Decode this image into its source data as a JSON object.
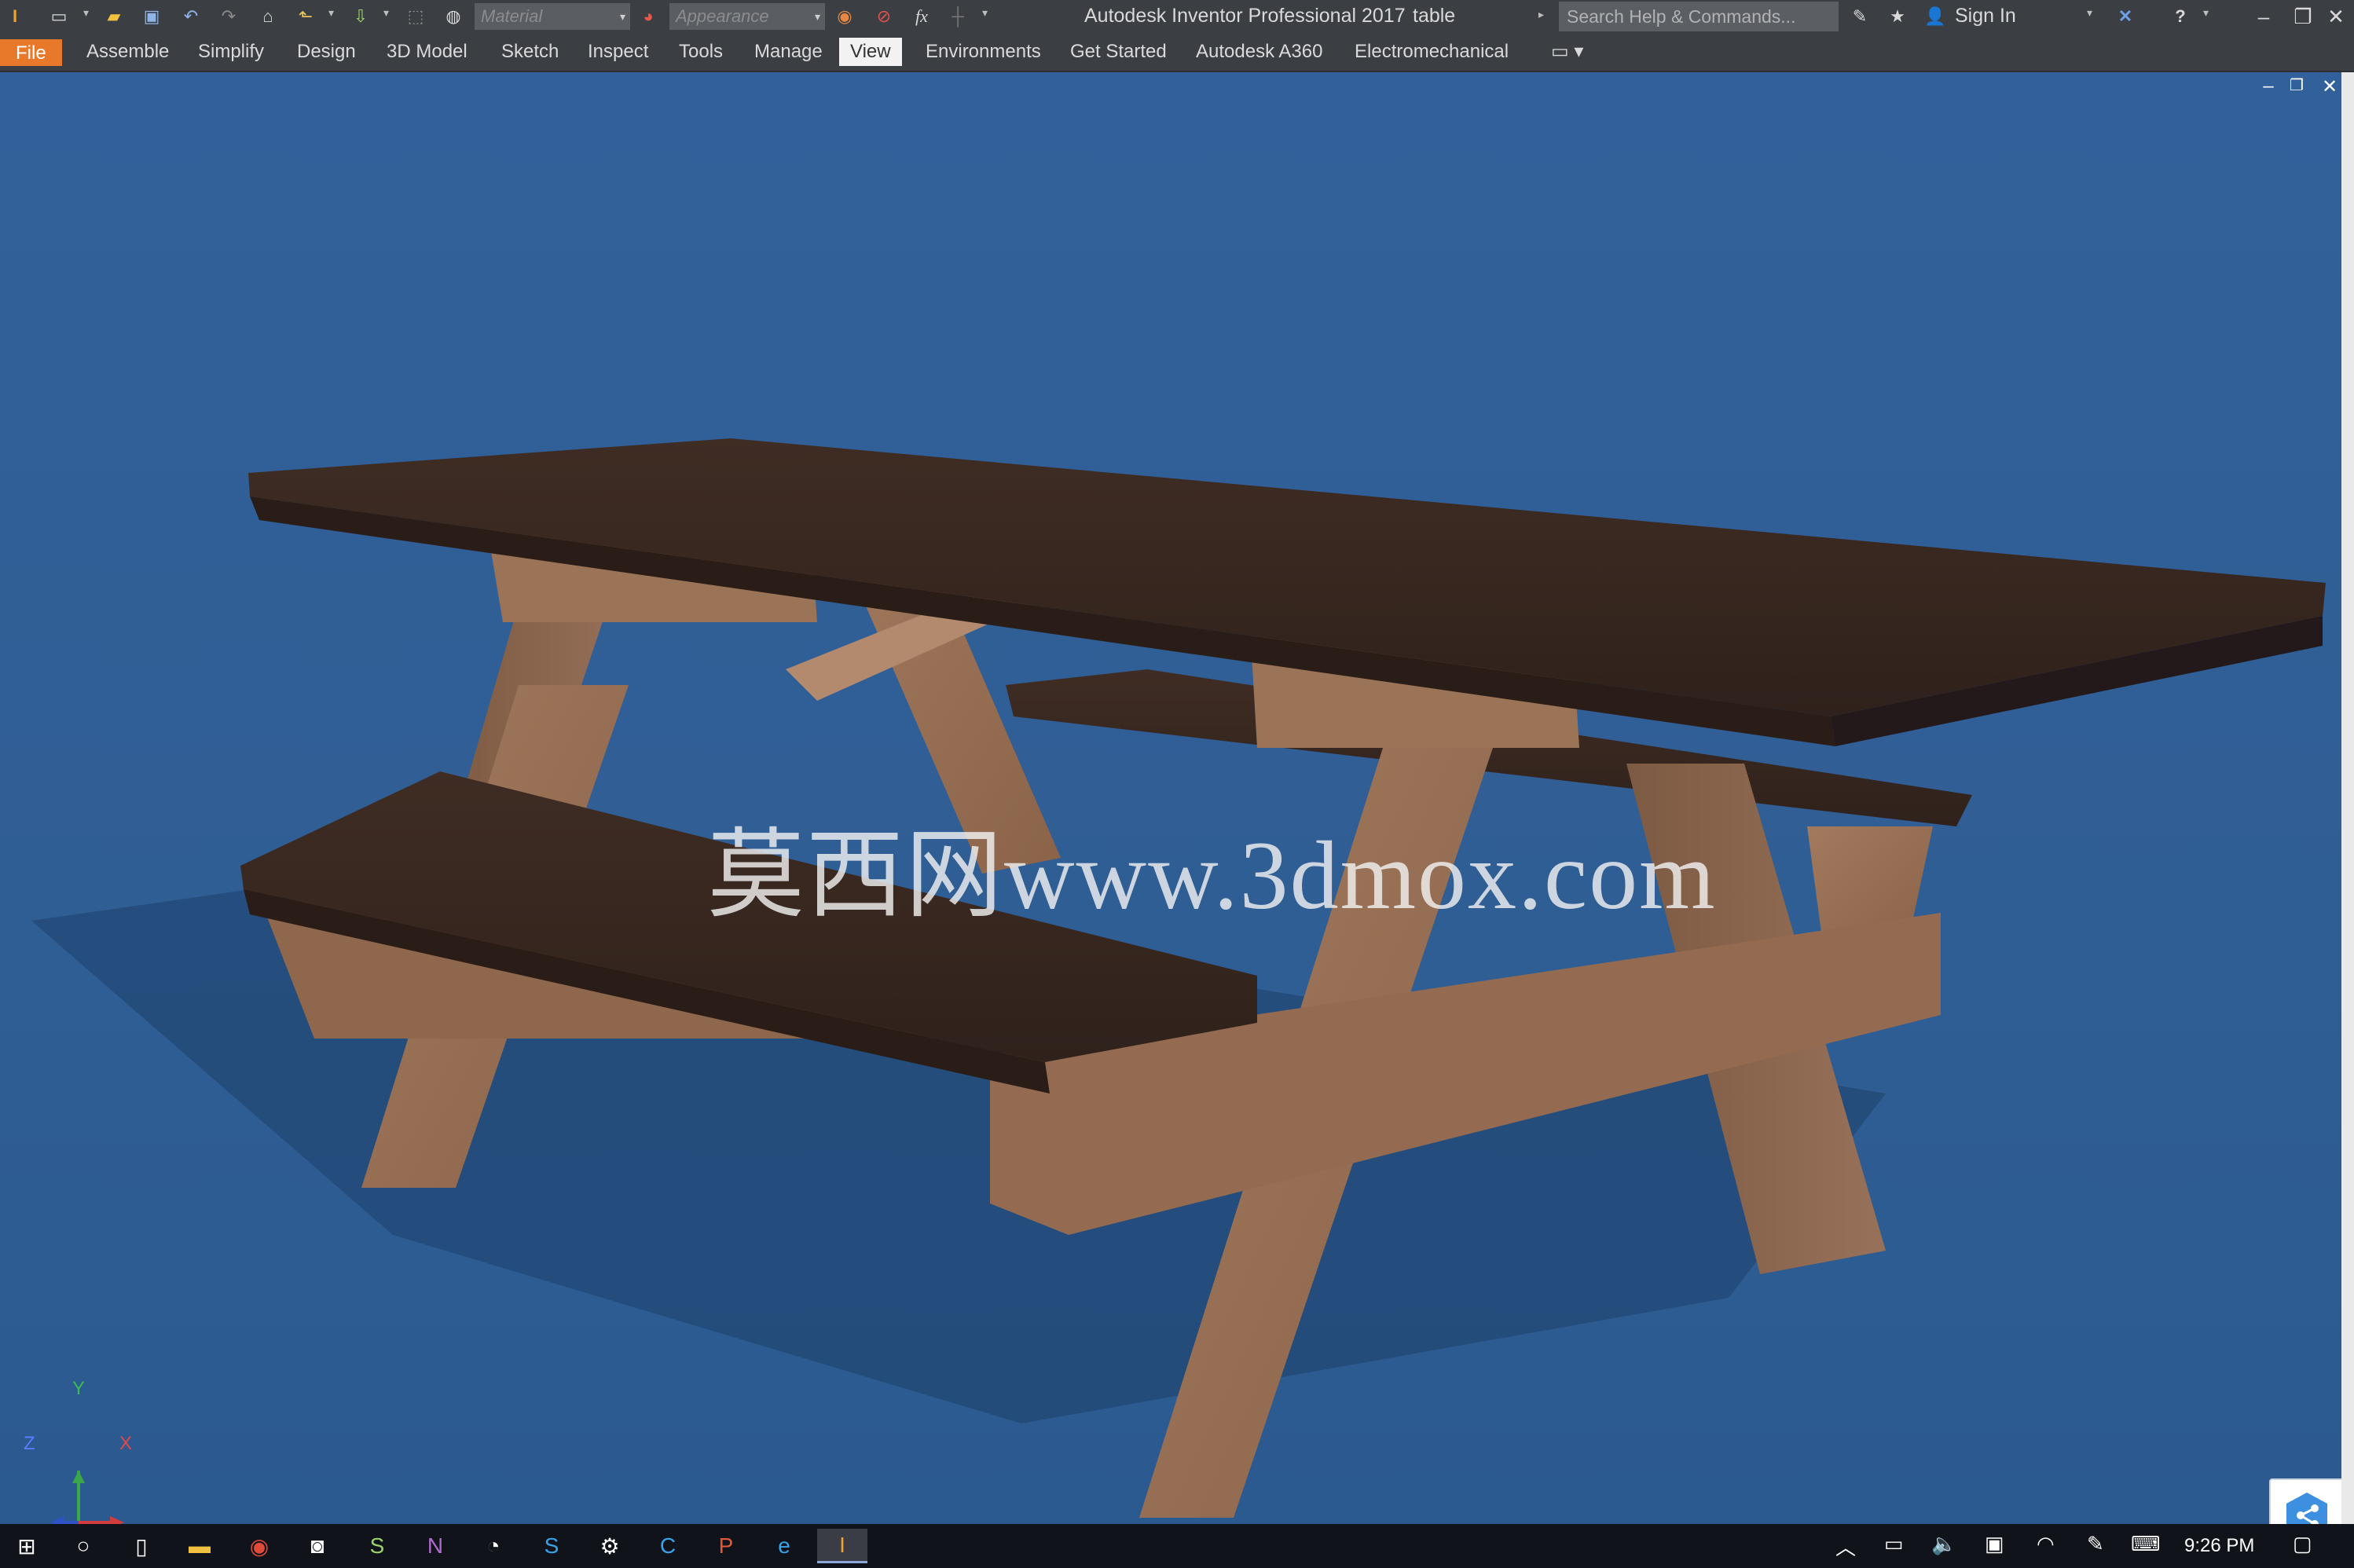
{
  "title_bar": {
    "app_title": "Autodesk Inventor Professional 2017",
    "doc_title": "table",
    "material_placeholder": "Material",
    "appearance_placeholder": "Appearance",
    "fx_label": "fx",
    "search_placeholder": "Search Help & Commands...",
    "sign_in": "Sign In",
    "help": "?"
  },
  "ribbon": {
    "tabs": [
      {
        "label": "File"
      },
      {
        "label": "Assemble"
      },
      {
        "label": "Simplify"
      },
      {
        "label": "Design"
      },
      {
        "label": "3D Model"
      },
      {
        "label": "Sketch"
      },
      {
        "label": "Inspect"
      },
      {
        "label": "Tools"
      },
      {
        "label": "Manage"
      },
      {
        "label": "View"
      },
      {
        "label": "Environments"
      },
      {
        "label": "Get Started"
      },
      {
        "label": "Autodesk A360"
      },
      {
        "label": "Electromechanical"
      }
    ],
    "active_tab": "View"
  },
  "viewport": {
    "watermark": "莫西网www.3dmox.com",
    "axes": {
      "y": "Y",
      "z": "Z",
      "x": "X"
    },
    "background_color": "#2f5e93"
  },
  "taskbar": {
    "clock": "9:26 PM"
  },
  "colors": {
    "accent": "#e9792a",
    "table_top": "#3b2a22",
    "wood": "#9a7358"
  }
}
